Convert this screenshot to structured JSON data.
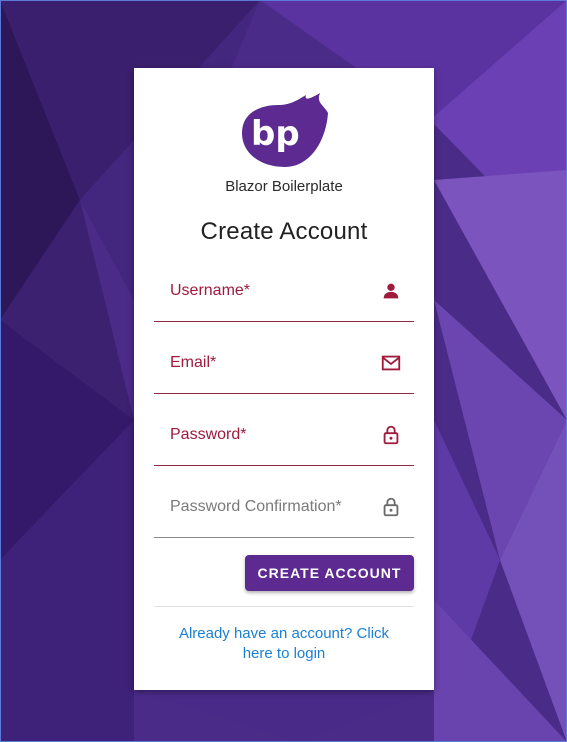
{
  "colors": {
    "primary": "#5c2a91",
    "error": "#a01a3c",
    "link": "#1a7fd4"
  },
  "brand": {
    "logo_text": "bp",
    "name": "Blazor Boilerplate"
  },
  "form": {
    "title": "Create Account",
    "fields": [
      {
        "label": "Username*",
        "icon": "person-icon",
        "state": "error"
      },
      {
        "label": "Email*",
        "icon": "mail-icon",
        "state": "error"
      },
      {
        "label": "Password*",
        "icon": "lock-icon",
        "state": "error"
      },
      {
        "label": "Password Confirmation*",
        "icon": "lock-icon",
        "state": "default"
      }
    ],
    "submit_label": "CREATE ACCOUNT",
    "login_link": "Already have an account? Click here to login"
  }
}
